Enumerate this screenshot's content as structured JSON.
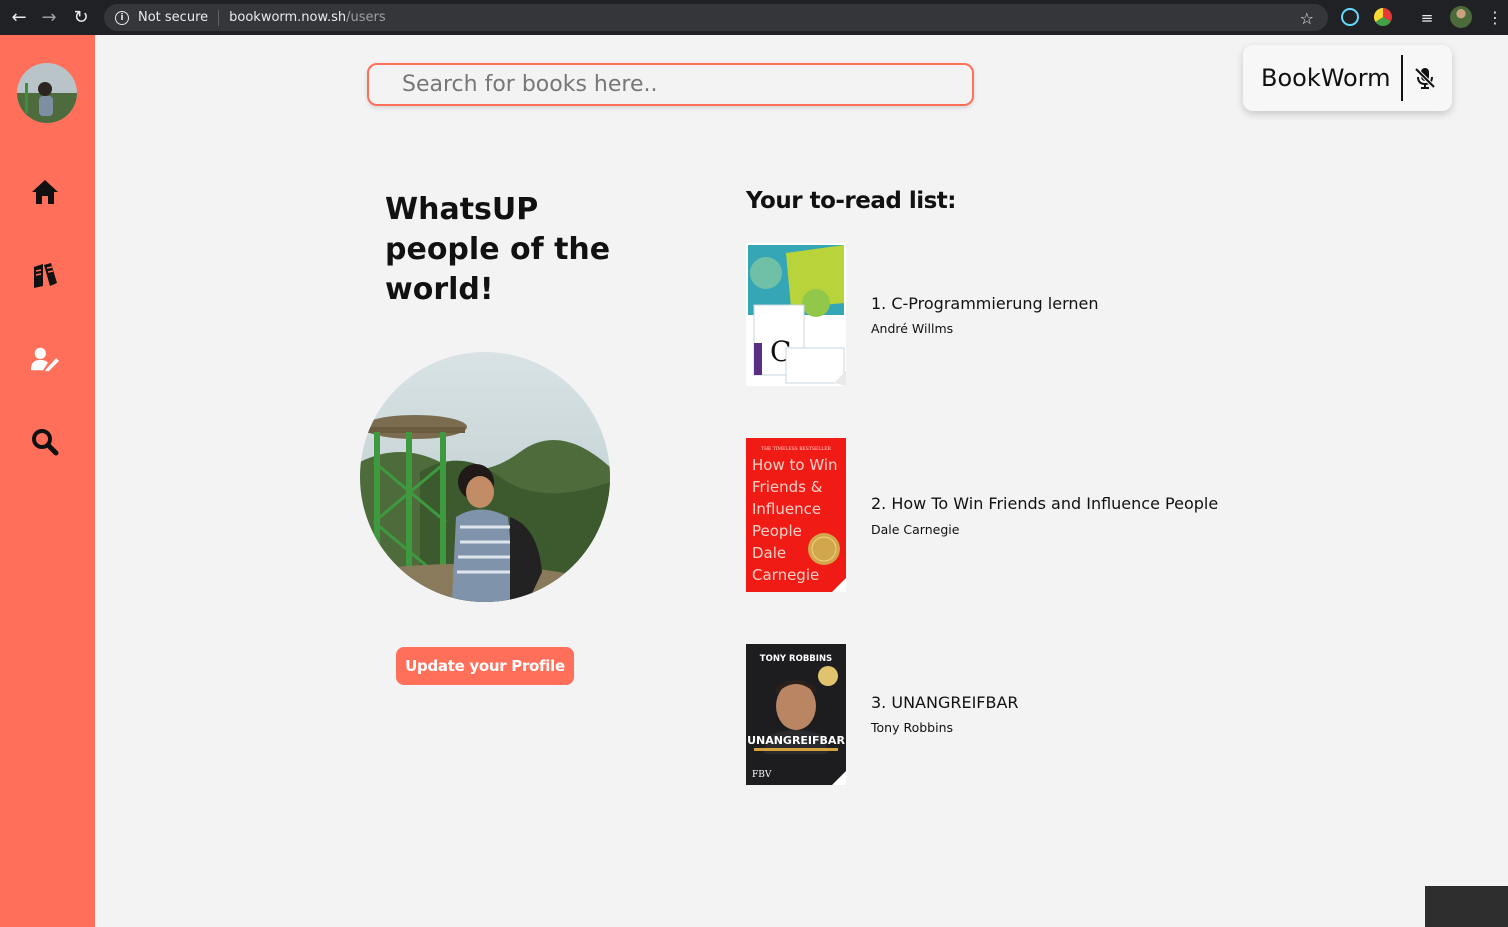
{
  "browser": {
    "security_label": "Not secure",
    "url_host": "bookworm.now.sh",
    "url_path": "/users"
  },
  "sidebar": {
    "items": [
      {
        "icon": "home-icon"
      },
      {
        "icon": "books-icon"
      },
      {
        "icon": "user-edit-icon"
      },
      {
        "icon": "search-icon"
      }
    ]
  },
  "search": {
    "placeholder": "Search for books here.."
  },
  "brand": {
    "name": "BookWorm",
    "icon": "mic-off-icon"
  },
  "profile": {
    "greeting": "WhatsUP people of the world!",
    "update_label": "Update your Profile"
  },
  "to_read": {
    "heading": "Your to-read list:",
    "books": [
      {
        "title": "1. C-Programmierung lernen",
        "author": "André Willms"
      },
      {
        "title": "2. How To Win Friends and Influence People",
        "author": "Dale Carnegie"
      },
      {
        "title": "3. UNANGREIFBAR",
        "author": "Tony Robbins"
      }
    ]
  },
  "covers": {
    "book2_line1": "How to Win",
    "book2_line2": "Friends &",
    "book2_line3": "Influence",
    "book2_line4": "People",
    "book2_line5": "Dale",
    "book2_line6": "Carnegie",
    "book2_banner": "THE TIMELESS BESTSELLER",
    "book3_author": "TONY ROBBINS",
    "book3_title": "UNANGREIFBAR",
    "book3_publisher": "FBV"
  },
  "colors": {
    "accent": "#ff6f59",
    "background": "#f3f3f3"
  }
}
